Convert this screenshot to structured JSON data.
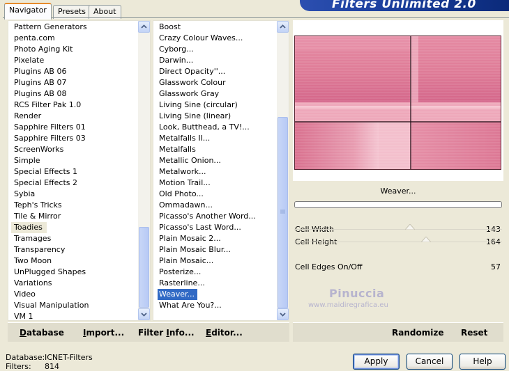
{
  "window": {
    "title": "Filters Unlimited 2.0",
    "colors": {
      "face": "#ece9d8",
      "selection": "#316ac5",
      "banner": "#1a3e9c"
    }
  },
  "tabs": [
    {
      "label": "Navigator",
      "active": true
    },
    {
      "label": "Presets",
      "active": false
    },
    {
      "label": "About",
      "active": false
    }
  ],
  "categories": {
    "items": [
      "Pattern Generators",
      "penta.com",
      "Photo Aging Kit",
      "Pixelate",
      "Plugins AB 06",
      "Plugins AB 07",
      "Plugins AB 08",
      "RCS Filter Pak 1.0",
      "Render",
      "Sapphire Filters 01",
      "Sapphire Filters 03",
      "ScreenWorks",
      "Simple",
      "Special Effects 1",
      "Special Effects 2",
      "Sybia",
      "Teph's Tricks",
      "Tile & Mirror",
      "Toadies",
      "Tramages",
      "Transparency",
      "Two Moon",
      "UnPlugged Shapes",
      "Variations",
      "Video",
      "Visual Manipulation",
      "VM 1"
    ],
    "selected": "Toadies"
  },
  "filters": {
    "items": [
      "Boost",
      "Crazy Colour Waves...",
      "Cyborg...",
      "Darwin...",
      "Direct Opacity''...",
      "Glasswork Colour",
      "Glasswork Gray",
      "Living Sine (circular)",
      "Living Sine (linear)",
      "Look, Butthead, a TV!...",
      "Metalfalls II...",
      "Metalfalls",
      "Metallic Onion...",
      "Metalwork...",
      "Motion Trail...",
      "Old Photo...",
      "Ommadawn...",
      "Picasso's Another Word...",
      "Picasso's Last Word...",
      "Plain Mosaic 2...",
      "Plain Mosaic Blur...",
      "Plain Mosaic...",
      "Posterize...",
      "Rasterline...",
      "Weaver...",
      "What Are You?..."
    ],
    "selected": "Weaver..."
  },
  "preview": {
    "filter_name": "Weaver...",
    "watermark_name": "Pinuccia",
    "watermark_site": "www.maidiregrafica.eu",
    "colors": {
      "base": "#e0809a",
      "light": "#f0b3c2",
      "dark": "#d35f80"
    }
  },
  "parameters": [
    {
      "label": "Cell Width",
      "value": "143"
    },
    {
      "label": "Cell Height",
      "value": "164"
    },
    {
      "label": "",
      "value": ""
    },
    {
      "label": "Cell Edges On/Off",
      "value": "57"
    }
  ],
  "sliders": [
    {
      "level": 0.56
    },
    {
      "level": 0.64
    }
  ],
  "bottom_left_buttons": [
    {
      "mnemonic": "D",
      "rest": "atabase"
    },
    {
      "mnemonic": "I",
      "rest": "mport..."
    },
    {
      "mnemonic": "",
      "before": "Filter ",
      "mnemonic2": "I",
      "rest": "nfo..."
    },
    {
      "mnemonic": "E",
      "rest": "ditor..."
    }
  ],
  "labels": {
    "database": "Database",
    "import": "Import...",
    "filter_info": "Filter Info...",
    "editor": "Editor...",
    "randomize": "Randomize",
    "reset": "Reset"
  },
  "status": {
    "database_label": "Database:",
    "database_value": "ICNET-Filters",
    "filters_label": "Filters:",
    "filters_value": "814"
  },
  "buttons": {
    "apply": "Apply",
    "cancel": "Cancel",
    "help": "Help"
  }
}
